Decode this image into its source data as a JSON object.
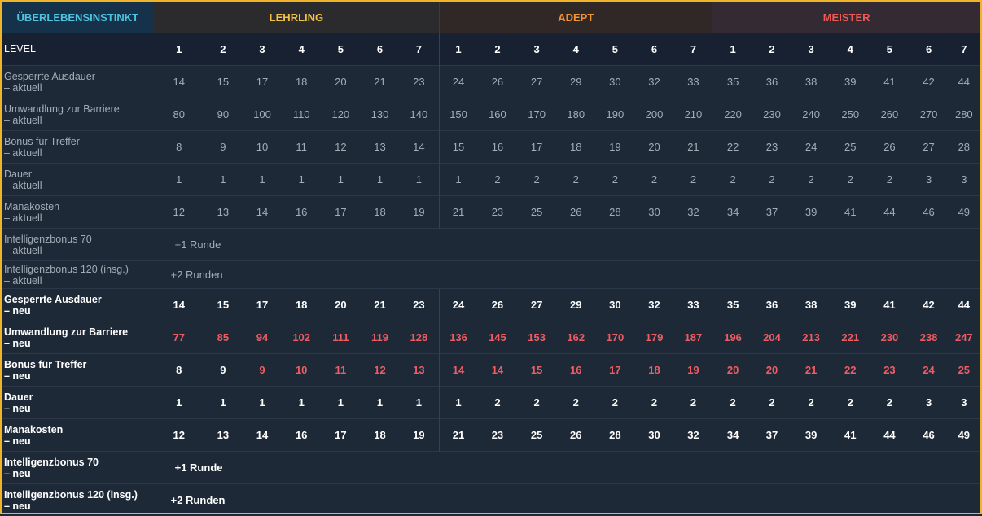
{
  "header": {
    "title": "ÜBERLEBENSINSTINKT",
    "groups": [
      "LEHRLING",
      "ADEPT",
      "MEISTER"
    ]
  },
  "level_row": {
    "label": "LEVEL",
    "levels": [
      "1",
      "2",
      "3",
      "4",
      "5",
      "6",
      "7",
      "1",
      "2",
      "3",
      "4",
      "5",
      "6",
      "7",
      "1",
      "2",
      "3",
      "4",
      "5",
      "6",
      "7"
    ]
  },
  "current_rows": [
    {
      "line1": "Gesperrte Ausdauer",
      "line2": "– aktuell",
      "values": [
        "14",
        "15",
        "17",
        "18",
        "20",
        "21",
        "23",
        "24",
        "26",
        "27",
        "29",
        "30",
        "32",
        "33",
        "35",
        "36",
        "38",
        "39",
        "41",
        "42",
        "44"
      ]
    },
    {
      "line1": "Umwandlung zur Barriere",
      "line2": "– aktuell",
      "values": [
        "80",
        "90",
        "100",
        "110",
        "120",
        "130",
        "140",
        "150",
        "160",
        "170",
        "180",
        "190",
        "200",
        "210",
        "220",
        "230",
        "240",
        "250",
        "260",
        "270",
        "280"
      ]
    },
    {
      "line1": "Bonus für Treffer",
      "line2": "– aktuell",
      "values": [
        "8",
        "9",
        "10",
        "11",
        "12",
        "13",
        "14",
        "15",
        "16",
        "17",
        "18",
        "19",
        "20",
        "21",
        "22",
        "23",
        "24",
        "25",
        "26",
        "27",
        "28"
      ]
    },
    {
      "line1": "Dauer",
      "line2": "– aktuell",
      "values": [
        "1",
        "1",
        "1",
        "1",
        "1",
        "1",
        "1",
        "1",
        "2",
        "2",
        "2",
        "2",
        "2",
        "2",
        "2",
        "2",
        "2",
        "2",
        "2",
        "3",
        "3"
      ]
    },
    {
      "line1": "Manakosten",
      "line2": "– aktuell",
      "values": [
        "12",
        "13",
        "14",
        "16",
        "17",
        "18",
        "19",
        "21",
        "23",
        "25",
        "26",
        "28",
        "30",
        "32",
        "34",
        "37",
        "39",
        "41",
        "44",
        "46",
        "49"
      ]
    }
  ],
  "current_text_rows": [
    {
      "line1": "Intelligenzbonus 70",
      "line2": "– aktuell",
      "text": "+1 Runde"
    },
    {
      "line1": "Intelligenzbonus 120 (insg.)",
      "line2": "– aktuell",
      "text": "+2 Runden"
    }
  ],
  "new_rows": [
    {
      "line1": "Gesperrte Ausdauer",
      "line2": "– neu",
      "values": [
        "14",
        "15",
        "17",
        "18",
        "20",
        "21",
        "23",
        "24",
        "26",
        "27",
        "29",
        "30",
        "32",
        "33",
        "35",
        "36",
        "38",
        "39",
        "41",
        "42",
        "44"
      ],
      "highlight_from": 21
    },
    {
      "line1": "Umwandlung zur Barriere",
      "line2": "– neu",
      "values": [
        "77",
        "85",
        "94",
        "102",
        "111",
        "119",
        "128",
        "136",
        "145",
        "153",
        "162",
        "170",
        "179",
        "187",
        "196",
        "204",
        "213",
        "221",
        "230",
        "238",
        "247"
      ],
      "highlight_from": 0
    },
    {
      "line1": "Bonus für Treffer",
      "line2": "– neu",
      "values": [
        "8",
        "9",
        "9",
        "10",
        "11",
        "12",
        "13",
        "14",
        "14",
        "15",
        "16",
        "17",
        "18",
        "19",
        "20",
        "20",
        "21",
        "22",
        "23",
        "24",
        "25"
      ],
      "highlight_from": 2
    },
    {
      "line1": "Dauer",
      "line2": "– neu",
      "values": [
        "1",
        "1",
        "1",
        "1",
        "1",
        "1",
        "1",
        "1",
        "2",
        "2",
        "2",
        "2",
        "2",
        "2",
        "2",
        "2",
        "2",
        "2",
        "2",
        "3",
        "3"
      ],
      "highlight_from": 21
    },
    {
      "line1": "Manakosten",
      "line2": "– neu",
      "values": [
        "12",
        "13",
        "14",
        "16",
        "17",
        "18",
        "19",
        "21",
        "23",
        "25",
        "26",
        "28",
        "30",
        "32",
        "34",
        "37",
        "39",
        "41",
        "44",
        "46",
        "49"
      ],
      "highlight_from": 21
    }
  ],
  "new_text_rows": [
    {
      "line1": "Intelligenzbonus 70",
      "line2": "– neu",
      "text": "+1 Runde"
    },
    {
      "line1": "Intelligenzbonus 120 (insg.)",
      "line2": "– neu",
      "text": "+2 Runden"
    }
  ],
  "colors": {
    "border": "#f0b429",
    "title": "#4dc4e0",
    "lehrling": "#f4c242",
    "adept": "#f09436",
    "meister": "#ee5a56",
    "changed_value": "#f05c62"
  }
}
